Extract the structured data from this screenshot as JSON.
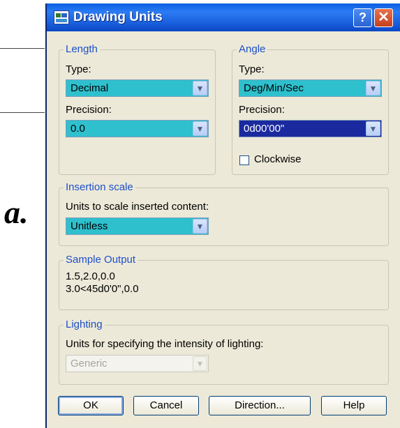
{
  "overlay_label": "a.",
  "dialog": {
    "title": "Drawing Units",
    "help_glyph": "?",
    "close_glyph": "✕"
  },
  "length": {
    "legend": "Length",
    "type_label": "Type:",
    "type_value": "Decimal",
    "precision_label": "Precision:",
    "precision_value": "0.0"
  },
  "angle": {
    "legend": "Angle",
    "type_label": "Type:",
    "type_value": "Deg/Min/Sec",
    "precision_label": "Precision:",
    "precision_value": "0d00'00\"",
    "clockwise_label": "Clockwise",
    "clockwise_checked": false
  },
  "insertion": {
    "legend": "Insertion scale",
    "units_label": "Units to scale inserted content:",
    "units_value": "Unitless"
  },
  "sample": {
    "legend": "Sample Output",
    "line1": "1.5,2.0,0.0",
    "line2": "3.0<45d0'0\",0.0"
  },
  "lighting": {
    "legend": "Lighting",
    "units_label": "Units for specifying the intensity of lighting:",
    "units_value": "Generic"
  },
  "buttons": {
    "ok": "OK",
    "cancel": "Cancel",
    "direction": "Direction...",
    "help": "Help"
  },
  "colors": {
    "accent": "#2ec0cd",
    "titlebar": "#1a5fdc",
    "legend_text": "#1c4fc9",
    "dialog_bg": "#ece9d8"
  },
  "icons": {
    "dropdown": "chevron-down-icon",
    "app": "drawing-units-icon"
  }
}
